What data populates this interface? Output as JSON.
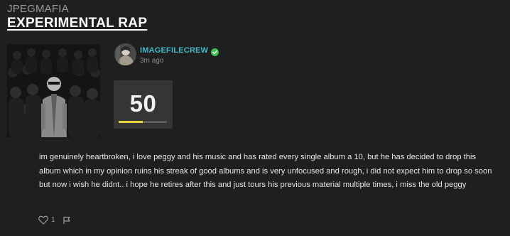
{
  "review": {
    "artist": "JPEGMAFIA",
    "album_title": "EXPERIMENTAL RAP",
    "cover_icon": "album-cover-image",
    "user": {
      "name": "IMAGEFILECREW",
      "verified": true,
      "time_ago": "3m ago",
      "avatar_icon": "user-avatar-image"
    },
    "score": {
      "value": "50",
      "fill_fraction": 0.5,
      "fill_color": "#e6d23f"
    },
    "text": "im genuinely heartbroken, i love peggy and his music and has rated every single album a 10, but he has decided to drop this album which in my opinion ruins his streak of good albums and is very unfocused and rough, i did not expect him to drop so soon but now i wish he didnt.. i hope he retires after this and just tours his previous material multiple times, i miss the old peggy",
    "likes": "1"
  },
  "colors": {
    "background": "#1f1f1f",
    "username": "#3fb9c4",
    "verified": "#3cbf4c",
    "score_box": "#353535"
  }
}
